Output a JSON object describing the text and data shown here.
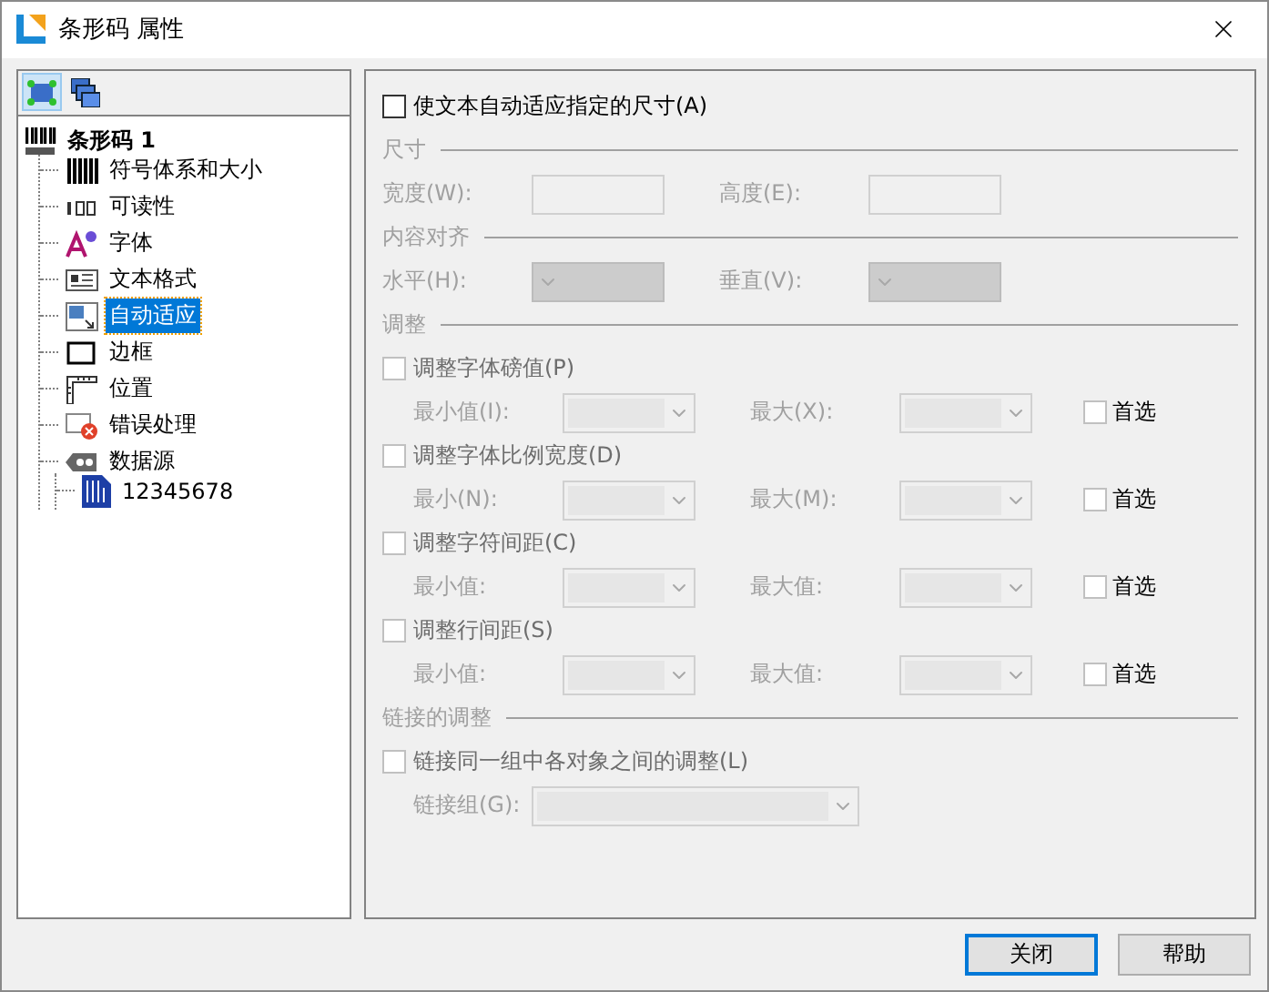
{
  "window": {
    "title": "条形码 属性"
  },
  "toolbar": [
    {
      "kind": "shape",
      "selected": true
    },
    {
      "kind": "layers",
      "selected": false
    }
  ],
  "tree": {
    "label": "条形码 1",
    "kind": "barcode",
    "selected": false,
    "children": [
      {
        "label": "符号体系和大小",
        "kind": "bars",
        "selected": false
      },
      {
        "label": "可读性",
        "kind": "digits",
        "selected": false
      },
      {
        "label": "字体",
        "kind": "font",
        "selected": false
      },
      {
        "label": "文本格式",
        "kind": "text",
        "selected": false
      },
      {
        "label": "自动适应",
        "kind": "fit",
        "selected": true
      },
      {
        "label": "边框",
        "kind": "frame",
        "selected": false
      },
      {
        "label": "位置",
        "kind": "ruler",
        "selected": false
      },
      {
        "label": "错误处理",
        "kind": "error",
        "selected": false
      },
      {
        "label": "数据源",
        "kind": "tag",
        "selected": false,
        "children": [
          {
            "label": "12345678",
            "kind": "file",
            "selected": false
          }
        ]
      }
    ]
  },
  "auto_fit": {
    "label": "使文本自动适应指定的尺寸(A)",
    "checked": false
  },
  "sections": [
    {
      "title": "尺寸",
      "rows": [
        {
          "kind": "fields",
          "fields": [
            {
              "label": "宽度(W):",
              "kind": "text"
            },
            {
              "label": "高度(E):",
              "kind": "text"
            }
          ]
        }
      ]
    },
    {
      "title": "内容对齐",
      "rows": [
        {
          "kind": "fields",
          "fields": [
            {
              "label": "水平(H):",
              "kind": "filled-combo"
            },
            {
              "label": "垂直(V):",
              "kind": "filled-combo"
            }
          ]
        }
      ]
    },
    {
      "title": "调整",
      "rows": [
        {
          "kind": "check",
          "label": "调整字体磅值(P)",
          "checked": false
        },
        {
          "kind": "sub-fields",
          "fields": [
            {
              "label": "最小值(I):",
              "kind": "combo"
            },
            {
              "label": "最大(X):",
              "kind": "combo"
            }
          ],
          "prefer": {
            "label": "首选",
            "checked": false
          }
        },
        {
          "kind": "check",
          "label": "调整字体比例宽度(D)",
          "checked": false
        },
        {
          "kind": "sub-fields",
          "fields": [
            {
              "label": "最小(N):",
              "kind": "combo"
            },
            {
              "label": "最大(M):",
              "kind": "combo"
            }
          ],
          "prefer": {
            "label": "首选",
            "checked": false
          }
        },
        {
          "kind": "check",
          "label": "调整字符间距(C)",
          "checked": false
        },
        {
          "kind": "sub-fields",
          "fields": [
            {
              "label": "最小值:",
              "kind": "combo"
            },
            {
              "label": "最大值:",
              "kind": "combo"
            }
          ],
          "prefer": {
            "label": "首选",
            "checked": false
          }
        },
        {
          "kind": "check",
          "label": "调整行间距(S)",
          "checked": false
        },
        {
          "kind": "sub-fields",
          "fields": [
            {
              "label": "最小值:",
              "kind": "combo"
            },
            {
              "label": "最大值:",
              "kind": "combo"
            }
          ],
          "prefer": {
            "label": "首选",
            "checked": false
          }
        }
      ]
    },
    {
      "title": "链接的调整",
      "rows": [
        {
          "kind": "check",
          "label": "链接同一组中各对象之间的调整(L)",
          "checked": false
        },
        {
          "kind": "sub-fields",
          "fields": [
            {
              "label": "链接组(G):",
              "kind": "wide-combo"
            }
          ]
        }
      ]
    }
  ],
  "buttons": [
    {
      "label": "关闭",
      "default": true
    },
    {
      "label": "帮助",
      "default": false
    }
  ]
}
